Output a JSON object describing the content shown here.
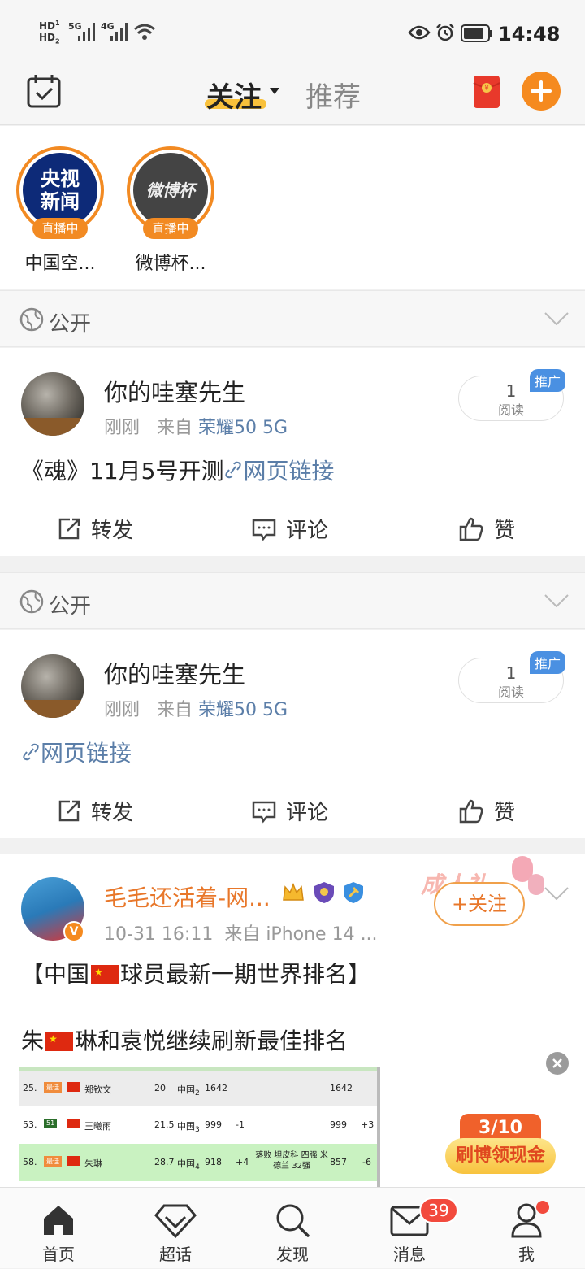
{
  "status_bar": {
    "hd1": "HD",
    "hd2": "HD",
    "net1": "5G",
    "net2": "4G",
    "time": "14:48"
  },
  "topbar": {
    "tab_follow": "关注",
    "tab_recommend": "推荐"
  },
  "stories": [
    {
      "avatar_text": "央视新闻",
      "badge": "直播中",
      "name": "中国空..."
    },
    {
      "avatar_text": "微博杯",
      "badge": "直播中",
      "name": "微博杯..."
    }
  ],
  "posts": [
    {
      "visibility": "公开",
      "user": "你的哇塞先生",
      "time": "刚刚",
      "from_label": "来自",
      "source": "荣耀50 5G",
      "read_count": "1",
      "read_label": "阅读",
      "promo_tag": "推广",
      "text_prefix": "《魂》11月5号开测",
      "link_text": "网页链接",
      "actions": {
        "repost": "转发",
        "comment": "评论",
        "like": "赞"
      }
    },
    {
      "visibility": "公开",
      "user": "你的哇塞先生",
      "time": "刚刚",
      "from_label": "来自",
      "source": "荣耀50 5G",
      "read_count": "1",
      "read_label": "阅读",
      "promo_tag": "推广",
      "text_prefix": "",
      "link_text": "网页链接",
      "actions": {
        "repost": "转发",
        "comment": "评论",
        "like": "赞"
      }
    }
  ],
  "post3": {
    "user": "毛毛还活着-网...",
    "time": "10-31 16:11",
    "source": "来自 iPhone 14 ...",
    "follow_label": "+关注",
    "banner_text": "成人礼",
    "line1_a": "【中国",
    "line1_b": "球员最新一期世界排名】",
    "line2_a": "朱",
    "line2_b": "琳和袁悦继续刷新最佳排名",
    "table": [
      {
        "rank": "25.",
        "tag": "最佳",
        "name": "郑钦文",
        "age": "20",
        "country": "中国",
        "cn": "2",
        "pts": "1642",
        "chg": "",
        "note": "",
        "pts2": "1642",
        "chg2": ""
      },
      {
        "rank": "53.",
        "tag": "51",
        "name": "王曦雨",
        "age": "21.5",
        "country": "中国",
        "cn": "3",
        "pts": "999",
        "chg": "-1",
        "note": "",
        "pts2": "999",
        "chg2": "+3"
      },
      {
        "rank": "58.",
        "tag": "最佳",
        "name": "朱琳",
        "age": "28.7",
        "country": "中国",
        "cn": "4",
        "pts": "918",
        "chg": "+4",
        "note": "落败 坦皮科 四强 米德兰 32强",
        "pts2": "857",
        "chg2": "-6"
      }
    ]
  },
  "reward": {
    "progress": "3/10",
    "label": "刷博领现金"
  },
  "bottom_nav": [
    {
      "label": "首页"
    },
    {
      "label": "超话"
    },
    {
      "label": "发现"
    },
    {
      "label": "消息",
      "badge": "39"
    },
    {
      "label": "我"
    }
  ]
}
